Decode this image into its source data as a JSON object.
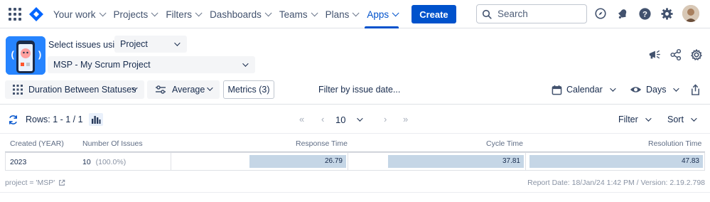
{
  "topnav": {
    "items": [
      {
        "label": "Your work"
      },
      {
        "label": "Projects"
      },
      {
        "label": "Filters"
      },
      {
        "label": "Dashboards"
      },
      {
        "label": "Teams"
      },
      {
        "label": "Plans"
      },
      {
        "label": "Apps"
      }
    ],
    "active_item": "Apps",
    "create_label": "Create",
    "search_placeholder": "Search"
  },
  "header": {
    "select_label": "Select issues using",
    "source_select": "Project",
    "project_select": "MSP - My Scrum Project"
  },
  "toolbar": {
    "report_type": "Duration Between Statuses",
    "aggregation": "Average",
    "metrics": "Metrics (3)",
    "filter_date": "Filter by issue date...",
    "calendar": "Calendar",
    "unit": "Days"
  },
  "pager": {
    "rows_label": "Rows: 1 - 1 / 1",
    "page_size": "10",
    "first": "«",
    "prev": "‹",
    "next": "›",
    "last": "»",
    "filter_label": "Filter",
    "sort_label": "Sort"
  },
  "table": {
    "headers": {
      "created": "Created (YEAR)",
      "issues": "Number Of Issues",
      "response": "Response Time",
      "cycle": "Cycle Time",
      "resolution": "Resolution Time"
    },
    "rows": [
      {
        "created": "2023",
        "issues": "10",
        "issues_pct": "(100.0%)",
        "response": "26.79",
        "cycle": "37.81",
        "resolution": "47.83"
      }
    ]
  },
  "footer": {
    "jql": "project = 'MSP'",
    "report_info": "Report Date: 18/Jan/24 1:42 PM / Version: 2.19.2.798"
  },
  "colors": {
    "primary": "#0052cc",
    "bar": "#c5d6e6",
    "app_icon_bg": "#2684ff"
  }
}
